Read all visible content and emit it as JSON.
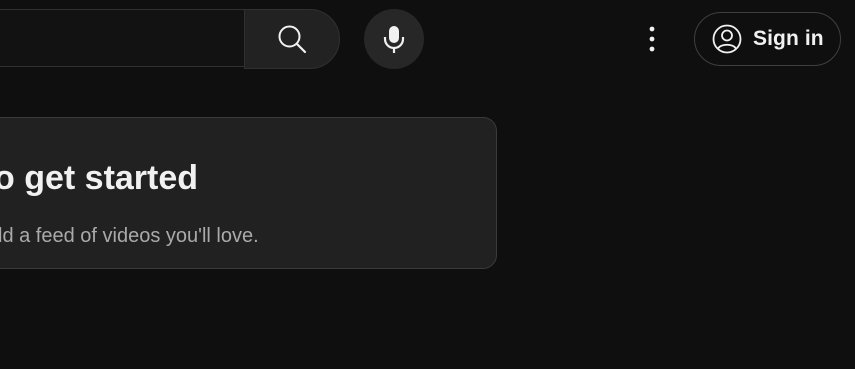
{
  "header": {
    "search": {
      "placeholder": "",
      "button_icon": "search-icon"
    },
    "voice": {
      "icon": "microphone-icon"
    },
    "more": {
      "icon": "more-vertical-icon"
    },
    "signin": {
      "icon": "account-circle-icon",
      "label": "Sign in"
    }
  },
  "main": {
    "prompt_card": {
      "title": "o get started",
      "subtitle": "ld a feed of videos you'll love."
    }
  }
}
